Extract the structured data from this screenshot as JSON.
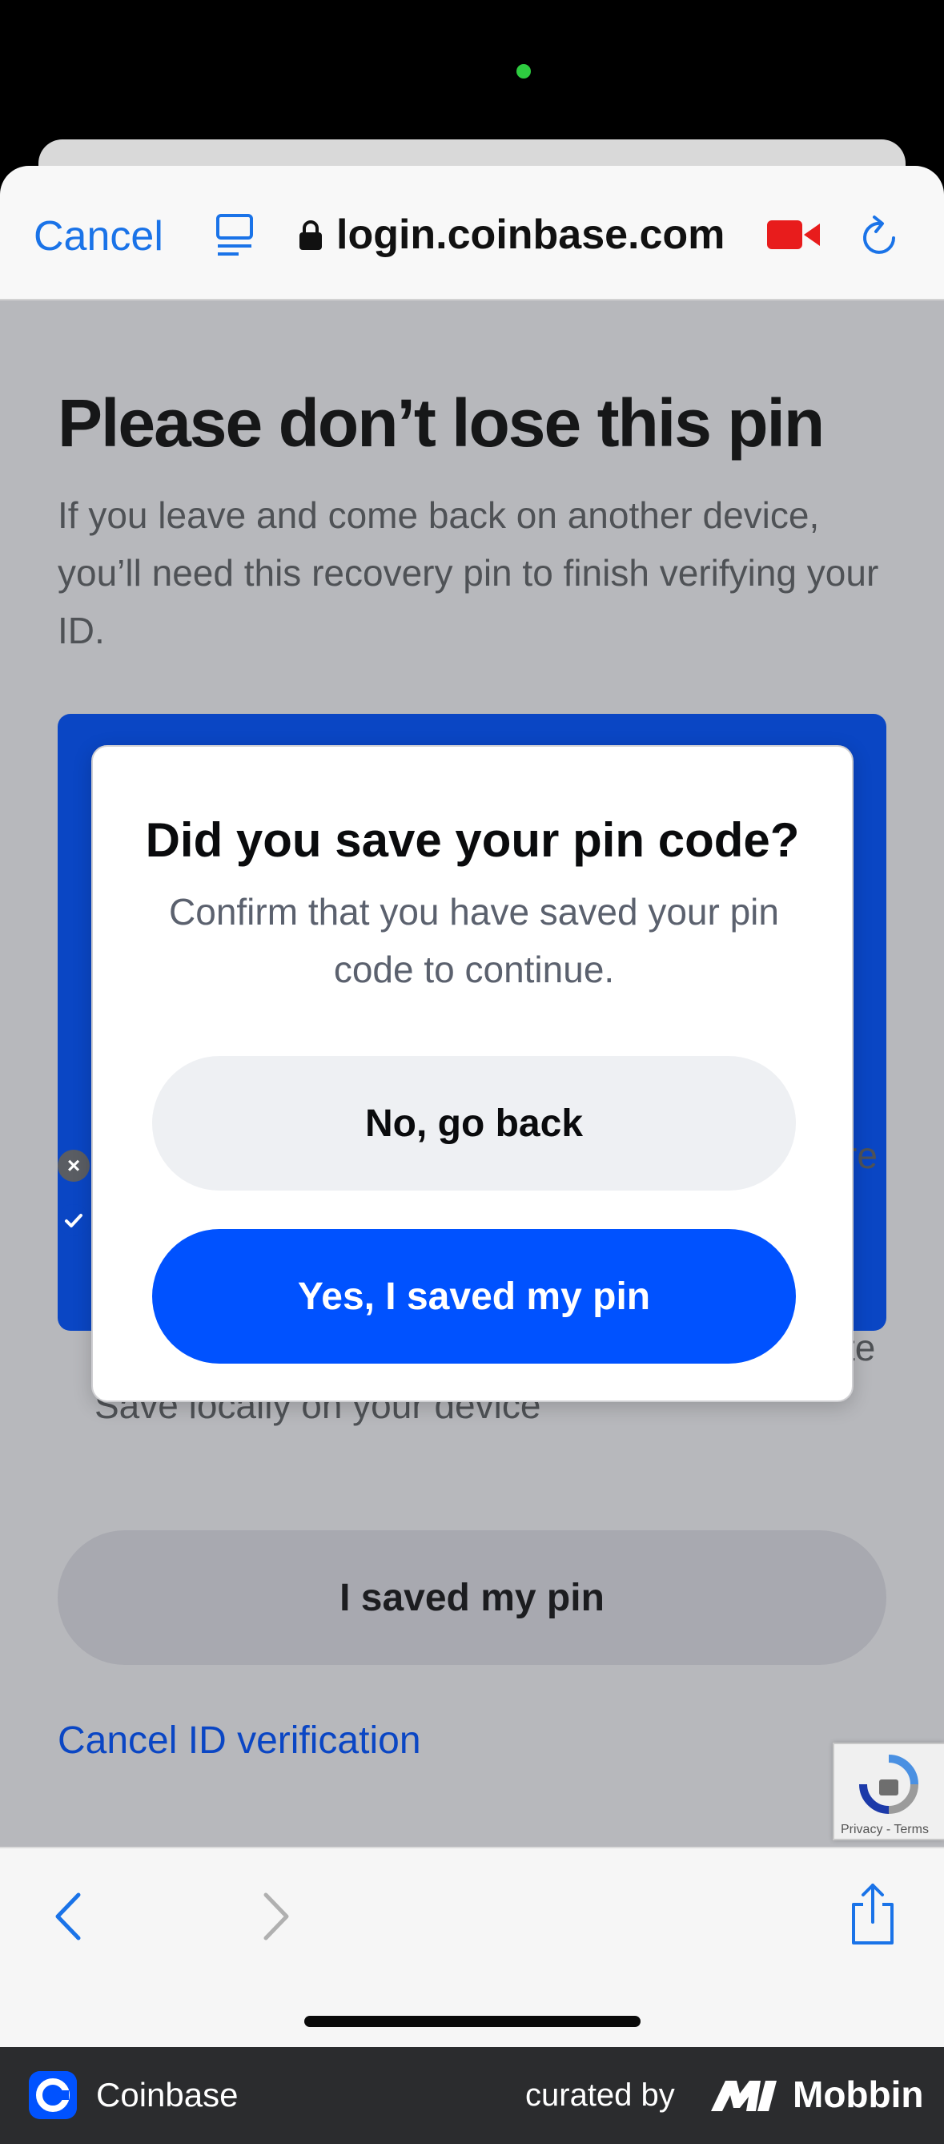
{
  "browser": {
    "cancel_label": "Cancel",
    "url": "login.coinbase.com"
  },
  "page": {
    "title": "Please don’t lose this pin",
    "description": "If you leave and come back on another device, you’ll need this recovery pin to finish verifying your ID.",
    "row_fragment_1": "re",
    "row_fragment_2": "te",
    "local_save_text": "Save locally on your device",
    "saved_button_label": "I saved my pin",
    "cancel_verification_label": "Cancel ID verification",
    "recaptcha_text": "Privacy - Terms"
  },
  "modal": {
    "title": "Did you save your pin code?",
    "description": "Confirm that you have saved your pin code to continue.",
    "secondary_label": "No, go back",
    "primary_label": "Yes, I saved my pin"
  },
  "footer": {
    "app_name": "Coinbase",
    "curated_by": "curated by",
    "brand": "Mobbin"
  },
  "colors": {
    "accent_blue": "#0052ff",
    "link_blue": "#1a73e8",
    "overlay_gray": "#b7b8bc"
  }
}
